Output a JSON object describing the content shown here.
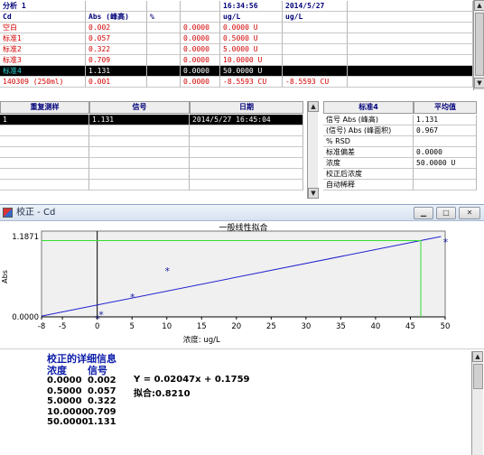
{
  "top_grid": {
    "header_row": [
      "分析 1",
      "",
      "",
      "",
      "16:34:56",
      "2014/5/27",
      ""
    ],
    "columns": [
      "Cd",
      "Abs (峰高)",
      "%",
      "",
      "ug/L",
      "ug/L",
      ""
    ],
    "rows": [
      {
        "cells": [
          "空白",
          "0.002",
          "",
          "0.0000",
          "0.0000 U",
          "",
          ""
        ],
        "selected": false,
        "color": "#d40000"
      },
      {
        "cells": [
          "标准1",
          "0.057",
          "",
          "0.0000",
          "0.5000 U",
          "",
          ""
        ],
        "selected": false,
        "color": "#d40000"
      },
      {
        "cells": [
          "标准2",
          "0.322",
          "",
          "0.0000",
          "5.0000 U",
          "",
          ""
        ],
        "selected": false,
        "color": "#d40000"
      },
      {
        "cells": [
          "标准3",
          "0.709",
          "",
          "0.0000",
          "10.0000 U",
          "",
          ""
        ],
        "selected": false,
        "color": "#d40000"
      },
      {
        "cells": [
          "标准4",
          "1.131",
          "",
          "0.0000",
          "50.0000 U",
          "",
          ""
        ],
        "selected": true,
        "color": "#2fd4d4"
      },
      {
        "cells": [
          "140309 (250ml)",
          "0.001",
          "",
          "0.0000",
          "-8.5593 CU",
          "-8.5593 CU",
          ""
        ],
        "selected": false,
        "color": "#d40000"
      }
    ]
  },
  "replicate_grid": {
    "headers": [
      "重复测样",
      "信号",
      "日期"
    ],
    "rows": [
      {
        "cells": [
          "1",
          "1.131",
          "2014/5/27 16:45:04"
        ],
        "selected": true
      }
    ]
  },
  "stats_panel": {
    "headers": [
      "标准4",
      "平均值"
    ],
    "rows": [
      {
        "label": "信号 Abs (峰高)",
        "value": "1.131"
      },
      {
        "label": "(信号) Abs (峰面积)",
        "value": "0.967"
      },
      {
        "label": "% RSD",
        "value": ""
      },
      {
        "label": "标准偏差",
        "value": "0.0000"
      },
      {
        "label": "浓度",
        "value": "50.0000 U"
      },
      {
        "label": "校正后浓度",
        "value": ""
      },
      {
        "label": "自动稀释",
        "value": ""
      }
    ]
  },
  "window": {
    "title": "校正 - Cd",
    "icon": "calibration-window-icon",
    "buttons": {
      "minimize": "minimize-icon",
      "maximize": "maximize-icon",
      "close": "close-icon"
    }
  },
  "chart_data": {
    "type": "scatter",
    "title": "一般线性拟合",
    "xlabel": "浓度: ug/L",
    "ylabel": "Abs",
    "xlim": [
      -8,
      50
    ],
    "ylim": [
      0.0,
      1.1871
    ],
    "x_ticks": [
      "-8",
      "-5",
      "0",
      "5",
      "10",
      "15",
      "20",
      "25",
      "30",
      "35",
      "40",
      "45",
      "50"
    ],
    "x_tick_values": [
      -8,
      -5,
      0,
      5,
      10,
      15,
      20,
      25,
      30,
      35,
      40,
      45,
      50
    ],
    "y_ticks": [
      "0.0000",
      "1.1871"
    ],
    "y_tick_values": [
      0.0,
      1.1871
    ],
    "points": [
      {
        "x": 0.0,
        "y": 0.002
      },
      {
        "x": 0.5,
        "y": 0.057
      },
      {
        "x": 5.0,
        "y": 0.322
      },
      {
        "x": 10.0,
        "y": 0.709
      },
      {
        "x": 50.0,
        "y": 1.131
      }
    ],
    "fit_line": {
      "slope": 0.02047,
      "intercept": 0.1759
    },
    "cursor_x": 46.5,
    "colors": {
      "line": "#2020d0",
      "points": "#1a1aa0",
      "cursor": "#33dd33",
      "plot_bg": "#f0f0f0"
    }
  },
  "details": {
    "title": "校正的详细信息",
    "col1": "浓度",
    "col2": "信号",
    "rows": [
      {
        "conc": "0.0000",
        "signal": "0.002"
      },
      {
        "conc": "0.5000",
        "signal": "0.057"
      },
      {
        "conc": "5.0000",
        "signal": "0.322"
      },
      {
        "conc": "10.0000",
        "signal": "0.709"
      },
      {
        "conc": "50.0000",
        "signal": "1.131"
      }
    ],
    "equation": "Y = 0.02047x + 0.1759",
    "fit": "拟合:0.8210"
  }
}
